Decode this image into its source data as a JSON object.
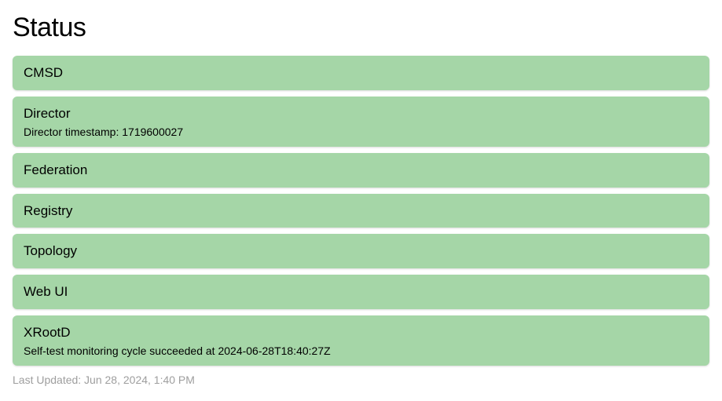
{
  "page": {
    "title": "Status",
    "last_updated": "Last Updated: Jun 28, 2024, 1:40 PM"
  },
  "status_items": [
    {
      "name": "CMSD",
      "detail": null
    },
    {
      "name": "Director",
      "detail": "Director timestamp: 1719600027"
    },
    {
      "name": "Federation",
      "detail": null
    },
    {
      "name": "Registry",
      "detail": null
    },
    {
      "name": "Topology",
      "detail": null
    },
    {
      "name": "Web UI",
      "detail": null
    },
    {
      "name": "XRootD",
      "detail": "Self-test monitoring cycle succeeded at 2024-06-28T18:40:27Z"
    }
  ],
  "colors": {
    "card_bg": "#a5d6a7",
    "text_primary": "#000000",
    "text_muted": "#9e9e9e"
  }
}
